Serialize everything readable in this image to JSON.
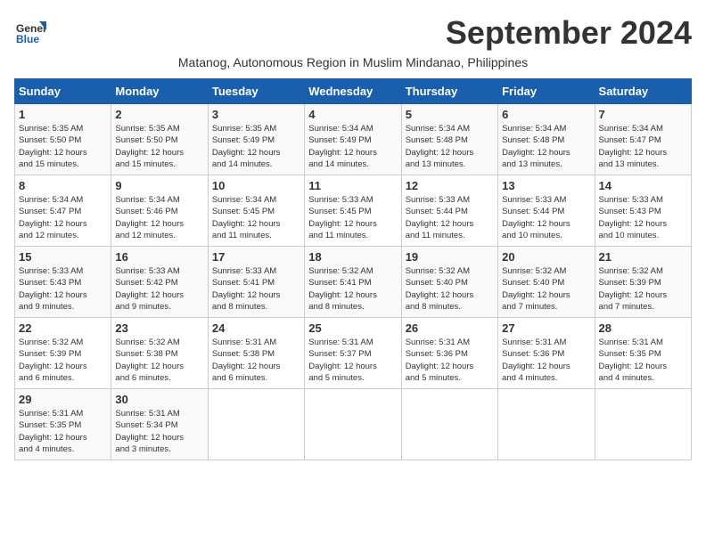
{
  "header": {
    "logo_text_general": "General",
    "logo_text_blue": "Blue",
    "month_title": "September 2024",
    "subtitle": "Matanog, Autonomous Region in Muslim Mindanao, Philippines"
  },
  "calendar": {
    "headers": [
      "Sunday",
      "Monday",
      "Tuesday",
      "Wednesday",
      "Thursday",
      "Friday",
      "Saturday"
    ],
    "weeks": [
      [
        {
          "day": "1",
          "info": "Sunrise: 5:35 AM\nSunset: 5:50 PM\nDaylight: 12 hours\nand 15 minutes."
        },
        {
          "day": "2",
          "info": "Sunrise: 5:35 AM\nSunset: 5:50 PM\nDaylight: 12 hours\nand 15 minutes."
        },
        {
          "day": "3",
          "info": "Sunrise: 5:35 AM\nSunset: 5:49 PM\nDaylight: 12 hours\nand 14 minutes."
        },
        {
          "day": "4",
          "info": "Sunrise: 5:34 AM\nSunset: 5:49 PM\nDaylight: 12 hours\nand 14 minutes."
        },
        {
          "day": "5",
          "info": "Sunrise: 5:34 AM\nSunset: 5:48 PM\nDaylight: 12 hours\nand 13 minutes."
        },
        {
          "day": "6",
          "info": "Sunrise: 5:34 AM\nSunset: 5:48 PM\nDaylight: 12 hours\nand 13 minutes."
        },
        {
          "day": "7",
          "info": "Sunrise: 5:34 AM\nSunset: 5:47 PM\nDaylight: 12 hours\nand 13 minutes."
        }
      ],
      [
        {
          "day": "8",
          "info": "Sunrise: 5:34 AM\nSunset: 5:47 PM\nDaylight: 12 hours\nand 12 minutes."
        },
        {
          "day": "9",
          "info": "Sunrise: 5:34 AM\nSunset: 5:46 PM\nDaylight: 12 hours\nand 12 minutes."
        },
        {
          "day": "10",
          "info": "Sunrise: 5:34 AM\nSunset: 5:45 PM\nDaylight: 12 hours\nand 11 minutes."
        },
        {
          "day": "11",
          "info": "Sunrise: 5:33 AM\nSunset: 5:45 PM\nDaylight: 12 hours\nand 11 minutes."
        },
        {
          "day": "12",
          "info": "Sunrise: 5:33 AM\nSunset: 5:44 PM\nDaylight: 12 hours\nand 11 minutes."
        },
        {
          "day": "13",
          "info": "Sunrise: 5:33 AM\nSunset: 5:44 PM\nDaylight: 12 hours\nand 10 minutes."
        },
        {
          "day": "14",
          "info": "Sunrise: 5:33 AM\nSunset: 5:43 PM\nDaylight: 12 hours\nand 10 minutes."
        }
      ],
      [
        {
          "day": "15",
          "info": "Sunrise: 5:33 AM\nSunset: 5:43 PM\nDaylight: 12 hours\nand 9 minutes."
        },
        {
          "day": "16",
          "info": "Sunrise: 5:33 AM\nSunset: 5:42 PM\nDaylight: 12 hours\nand 9 minutes."
        },
        {
          "day": "17",
          "info": "Sunrise: 5:33 AM\nSunset: 5:41 PM\nDaylight: 12 hours\nand 8 minutes."
        },
        {
          "day": "18",
          "info": "Sunrise: 5:32 AM\nSunset: 5:41 PM\nDaylight: 12 hours\nand 8 minutes."
        },
        {
          "day": "19",
          "info": "Sunrise: 5:32 AM\nSunset: 5:40 PM\nDaylight: 12 hours\nand 8 minutes."
        },
        {
          "day": "20",
          "info": "Sunrise: 5:32 AM\nSunset: 5:40 PM\nDaylight: 12 hours\nand 7 minutes."
        },
        {
          "day": "21",
          "info": "Sunrise: 5:32 AM\nSunset: 5:39 PM\nDaylight: 12 hours\nand 7 minutes."
        }
      ],
      [
        {
          "day": "22",
          "info": "Sunrise: 5:32 AM\nSunset: 5:39 PM\nDaylight: 12 hours\nand 6 minutes."
        },
        {
          "day": "23",
          "info": "Sunrise: 5:32 AM\nSunset: 5:38 PM\nDaylight: 12 hours\nand 6 minutes."
        },
        {
          "day": "24",
          "info": "Sunrise: 5:31 AM\nSunset: 5:38 PM\nDaylight: 12 hours\nand 6 minutes."
        },
        {
          "day": "25",
          "info": "Sunrise: 5:31 AM\nSunset: 5:37 PM\nDaylight: 12 hours\nand 5 minutes."
        },
        {
          "day": "26",
          "info": "Sunrise: 5:31 AM\nSunset: 5:36 PM\nDaylight: 12 hours\nand 5 minutes."
        },
        {
          "day": "27",
          "info": "Sunrise: 5:31 AM\nSunset: 5:36 PM\nDaylight: 12 hours\nand 4 minutes."
        },
        {
          "day": "28",
          "info": "Sunrise: 5:31 AM\nSunset: 5:35 PM\nDaylight: 12 hours\nand 4 minutes."
        }
      ],
      [
        {
          "day": "29",
          "info": "Sunrise: 5:31 AM\nSunset: 5:35 PM\nDaylight: 12 hours\nand 4 minutes."
        },
        {
          "day": "30",
          "info": "Sunrise: 5:31 AM\nSunset: 5:34 PM\nDaylight: 12 hours\nand 3 minutes."
        },
        {
          "day": "",
          "info": ""
        },
        {
          "day": "",
          "info": ""
        },
        {
          "day": "",
          "info": ""
        },
        {
          "day": "",
          "info": ""
        },
        {
          "day": "",
          "info": ""
        }
      ]
    ]
  }
}
